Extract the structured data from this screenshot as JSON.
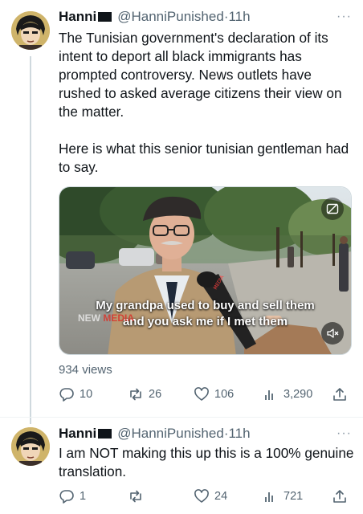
{
  "tweets": [
    {
      "display_name": "Hanni",
      "handle": "@HanniPunished",
      "separator": "·",
      "time": "11h",
      "more_label": "···",
      "text_paragraphs": [
        "The Tunisian government's declaration of its intent to deport all black immigrants has prompted controversy. News outlets have rushed to asked  average citizens their view on the matter.",
        "Here is what this senior tunisian gentleman had to say."
      ],
      "media": {
        "type": "video",
        "subtitle_line1": "My grandpa used to buy and sell them",
        "subtitle_line2": "and you ask me if I met them",
        "watermark_prefix": "NEW ",
        "watermark_red": "MEDIA",
        "mic_label": "MEDIA",
        "gif_icon": "gif-icon",
        "mute_icon": "muted-speaker-icon"
      },
      "views_text": "934 views",
      "actions": {
        "replies": "10",
        "retweets": "26",
        "likes": "106",
        "views": "3,290"
      }
    },
    {
      "display_name": "Hanni",
      "handle": "@HanniPunished",
      "separator": "·",
      "time": "11h",
      "more_label": "···",
      "text_paragraphs": [
        "I am NOT making this up this is a 100% genuine translation."
      ],
      "actions": {
        "replies": "1",
        "retweets": "",
        "likes": "24",
        "views": "721"
      }
    }
  ],
  "colors": {
    "text": "#0f1419",
    "secondary": "#536471",
    "thread_line": "#cfd9de"
  }
}
